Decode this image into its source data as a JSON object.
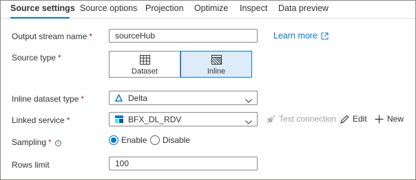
{
  "tabs": [
    {
      "label": "Source settings"
    },
    {
      "label": "Source options"
    },
    {
      "label": "Projection"
    },
    {
      "label": "Optimize"
    },
    {
      "label": "Inspect"
    },
    {
      "label": "Data preview"
    }
  ],
  "active_tab": "Source settings",
  "output_stream": {
    "label": "Output stream name",
    "required": "*",
    "value": "sourceHub",
    "learn_more": "Learn more"
  },
  "source_type": {
    "label": "Source type",
    "required": "*",
    "options": [
      {
        "label": "Dataset",
        "icon": "table-icon"
      },
      {
        "label": "Inline",
        "icon": "hatched-box-icon"
      }
    ],
    "selected": "Inline"
  },
  "inline_dataset_type": {
    "label": "Inline dataset type",
    "required": "*",
    "value": "Delta",
    "icon": "delta-icon"
  },
  "linked_service": {
    "label": "Linked service",
    "required": "*",
    "value": "BFX_DL_RDV",
    "icon": "data-lake-icon",
    "test_connection": "Test connection",
    "edit": "Edit",
    "new": "New"
  },
  "sampling": {
    "label": "Sampling",
    "required": "*",
    "info_icon": "info-icon",
    "options": [
      "Enable",
      "Disable"
    ],
    "selected": "Enable"
  },
  "rows_limit": {
    "label": "Rows limit",
    "value": "100"
  },
  "colors": {
    "accent": "#0078d4",
    "required": "#a4262c",
    "disabled": "#a19f9d",
    "selected_bg": "#deecf9"
  }
}
